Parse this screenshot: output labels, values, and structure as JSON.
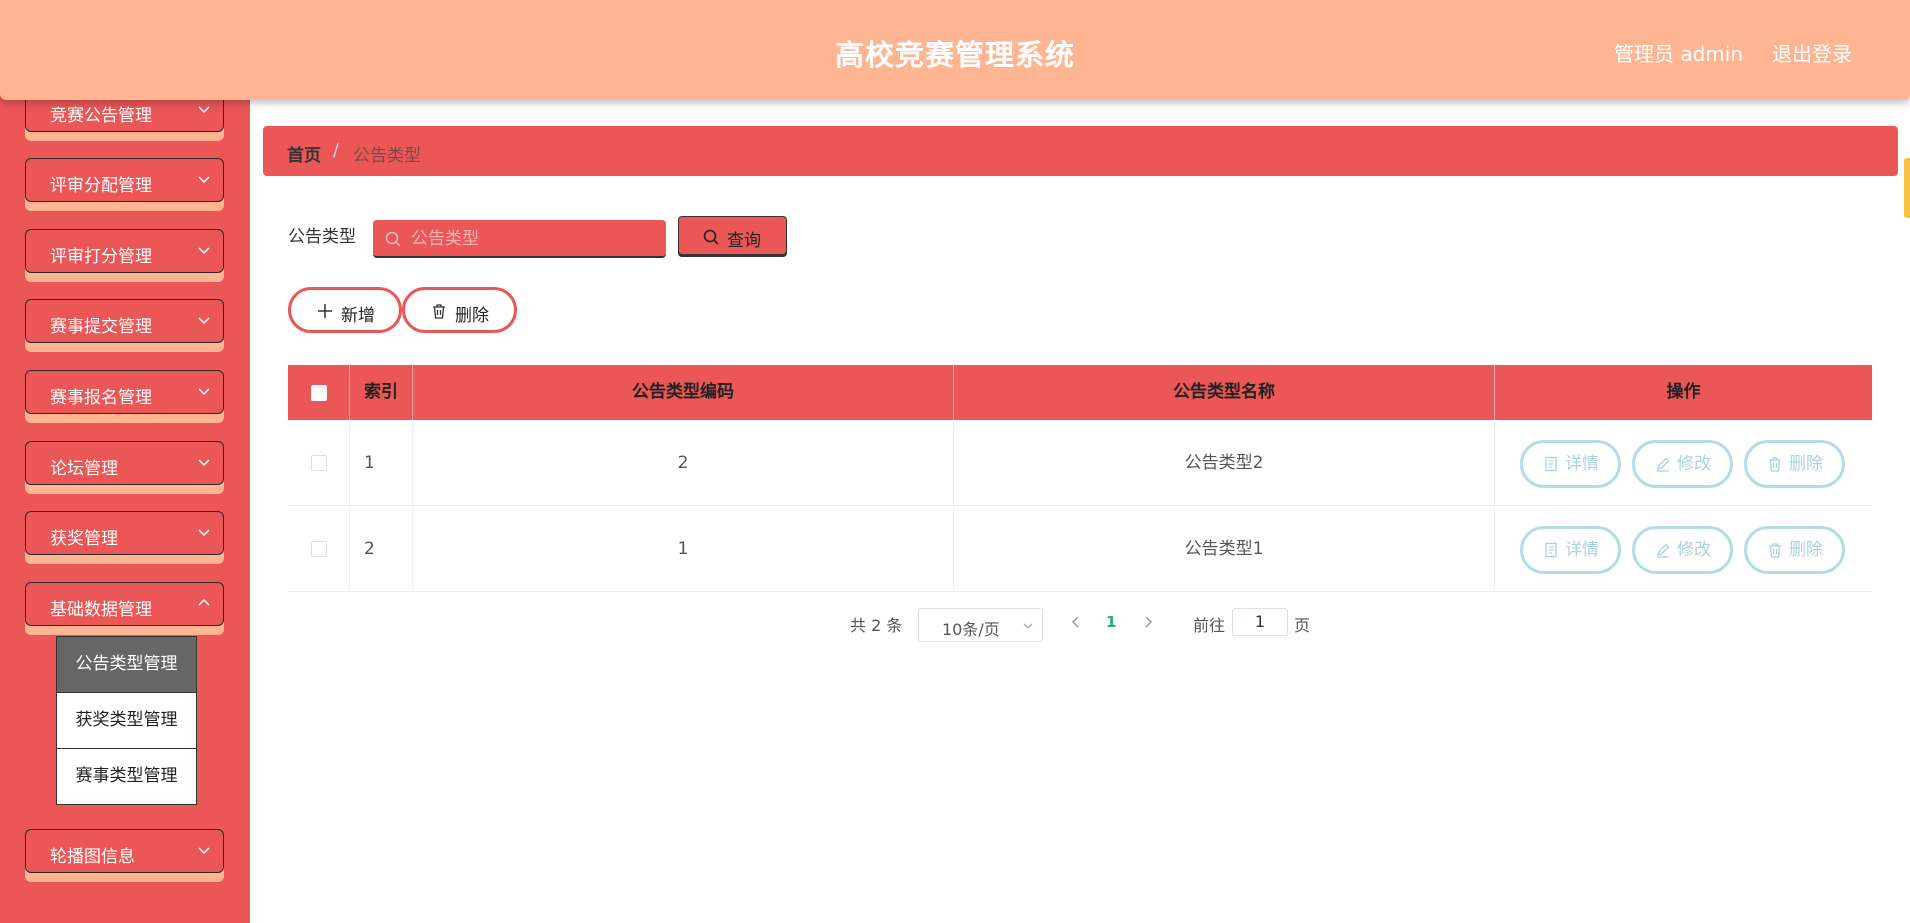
{
  "header": {
    "title": "高校竞赛管理系统",
    "user": "管理员 admin",
    "logout": "退出登录"
  },
  "sidebar": {
    "items": [
      {
        "label": "竞赛公告管理"
      },
      {
        "label": "评审分配管理"
      },
      {
        "label": "评审打分管理"
      },
      {
        "label": "赛事提交管理"
      },
      {
        "label": "赛事报名管理"
      },
      {
        "label": "论坛管理"
      },
      {
        "label": "获奖管理"
      },
      {
        "label": "基础数据管理"
      },
      {
        "label": "轮播图信息"
      }
    ],
    "submenu": [
      {
        "label": "公告类型管理",
        "active": true
      },
      {
        "label": "获奖类型管理"
      },
      {
        "label": "赛事类型管理"
      }
    ]
  },
  "breadcrumb": {
    "home": "首页",
    "separator": "/",
    "current": "公告类型"
  },
  "search": {
    "label": "公告类型",
    "placeholder": "公告类型",
    "button": "查询"
  },
  "actions": {
    "add": "新增",
    "delete": "删除"
  },
  "table": {
    "columns": [
      "索引",
      "公告类型编码",
      "公告类型名称",
      "操作"
    ],
    "rows": [
      {
        "index": "1",
        "code": "2",
        "name": "公告类型2"
      },
      {
        "index": "2",
        "code": "1",
        "name": "公告类型1"
      }
    ],
    "ops": {
      "detail": "详情",
      "edit": "修改",
      "delete": "删除"
    }
  },
  "pagination": {
    "total": "共 2 条",
    "page_size": "10条/页",
    "current_page": "1",
    "goto": "前往",
    "jump_value": "1",
    "page_unit": "页"
  },
  "colors": {
    "primary": "#eb5656",
    "header": "#ffb592",
    "op_button": "#b3dcea"
  }
}
